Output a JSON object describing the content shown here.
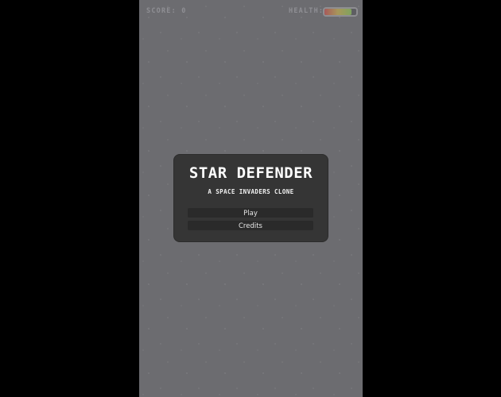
{
  "hud": {
    "score_label": "SCORE: 0",
    "health_label": "HEALTH:",
    "health_fraction": 0.85,
    "health_colors": [
      "#a85a5a",
      "#a8975a",
      "#7fa35f"
    ]
  },
  "menu": {
    "title": "STAR DEFENDER",
    "subtitle": "A SPACE INVADERS CLONE",
    "play_label": "Play",
    "credits_label": "Credits"
  },
  "colors": {
    "background_outside": "#000000",
    "game_background": "#6c6c70",
    "panel_background": "#353535",
    "button_background": "#2a2a2a",
    "text": "#ffffff"
  }
}
